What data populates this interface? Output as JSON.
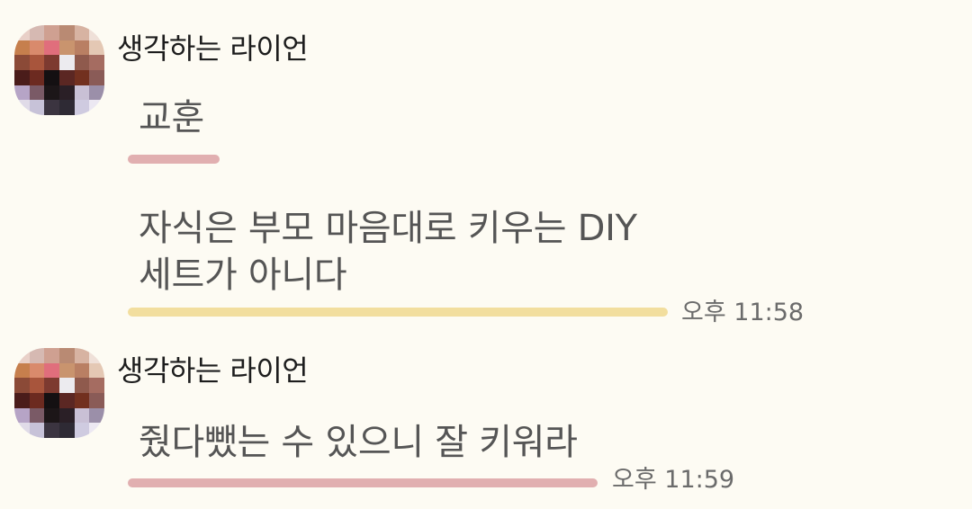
{
  "messages": [
    {
      "sender": "생각하는 라이언",
      "title": "교훈",
      "body_line1": "자식은 부모 마음대로 키우는 DIY",
      "body_line2": "세트가 아니다",
      "time": "오후 11:58"
    },
    {
      "sender": "생각하는 라이언",
      "body_line1": "줬다뺐는 수 있으니 잘 키워라",
      "time": "오후 11:59"
    }
  ],
  "colors": {
    "background": "#fdfbf3",
    "underline_pink": "#e1afb0",
    "underline_yellow": "#f2de9e",
    "message_text": "#555555",
    "sender_text": "#1d1d1d",
    "timestamp_text": "#6b6b6b"
  },
  "icons": {
    "avatar": "pixelated-profile-avatar"
  }
}
